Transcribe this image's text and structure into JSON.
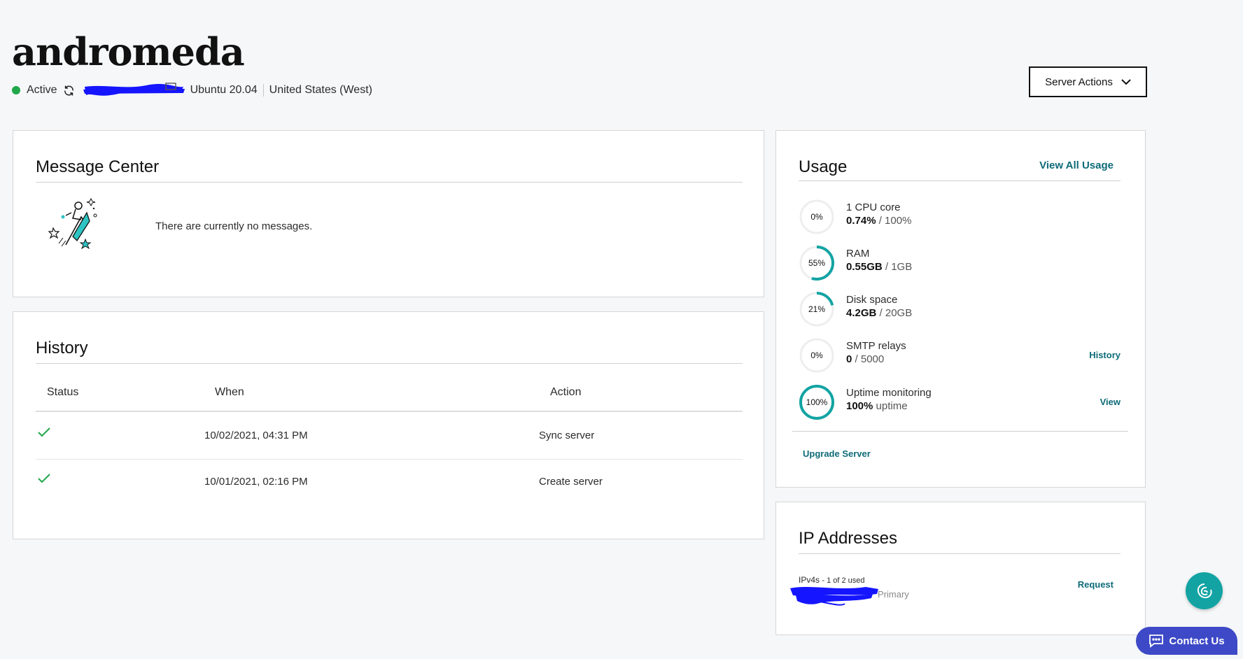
{
  "header": {
    "title": "andromeda",
    "status": "Active",
    "os": "Ubuntu 20.04",
    "region": "United States (West)",
    "actions_label": "Server Actions"
  },
  "colors": {
    "status_active": "#1fa74a",
    "accent": "#0e6b78",
    "ring": "#13a3a3",
    "contact_bg": "#3d49c6",
    "redaction": "#1515ff"
  },
  "message_center": {
    "title": "Message Center",
    "empty_text": "There are currently no messages."
  },
  "history": {
    "title": "History",
    "columns": [
      "Status",
      "When",
      "Action"
    ],
    "rows": [
      {
        "status": "success",
        "when": "10/02/2021, 04:31 PM",
        "action": "Sync server"
      },
      {
        "status": "success",
        "when": "10/01/2021, 02:16 PM",
        "action": "Create server"
      }
    ]
  },
  "usage": {
    "title": "Usage",
    "view_all": "View All Usage",
    "items": [
      {
        "pct_label": "0%",
        "fraction": 0.0,
        "name": "1 CPU core",
        "used": "0.74%",
        "total": "/ 100%",
        "link": ""
      },
      {
        "pct_label": "55%",
        "fraction": 0.55,
        "name": "RAM",
        "used": "0.55GB",
        "total": "/ 1GB",
        "link": ""
      },
      {
        "pct_label": "21%",
        "fraction": 0.21,
        "name": "Disk space",
        "used": "4.2GB",
        "total": "/ 20GB",
        "link": ""
      },
      {
        "pct_label": "0%",
        "fraction": 0.0,
        "name": "SMTP relays",
        "used": "0",
        "total": "/ 5000",
        "link": "History"
      },
      {
        "pct_label": "100%",
        "fraction": 1.0,
        "name": "Uptime monitoring",
        "used": "100%",
        "total": "uptime",
        "link": "View"
      }
    ],
    "upgrade": "Upgrade Server"
  },
  "ip": {
    "title": "IP Addresses",
    "label": "IPv4s",
    "count": "- 1 of 2 used",
    "primary": "Primary",
    "request": "Request"
  },
  "floating": {
    "help_icon": "chat-assistant-icon",
    "contact_label": "Contact Us"
  }
}
